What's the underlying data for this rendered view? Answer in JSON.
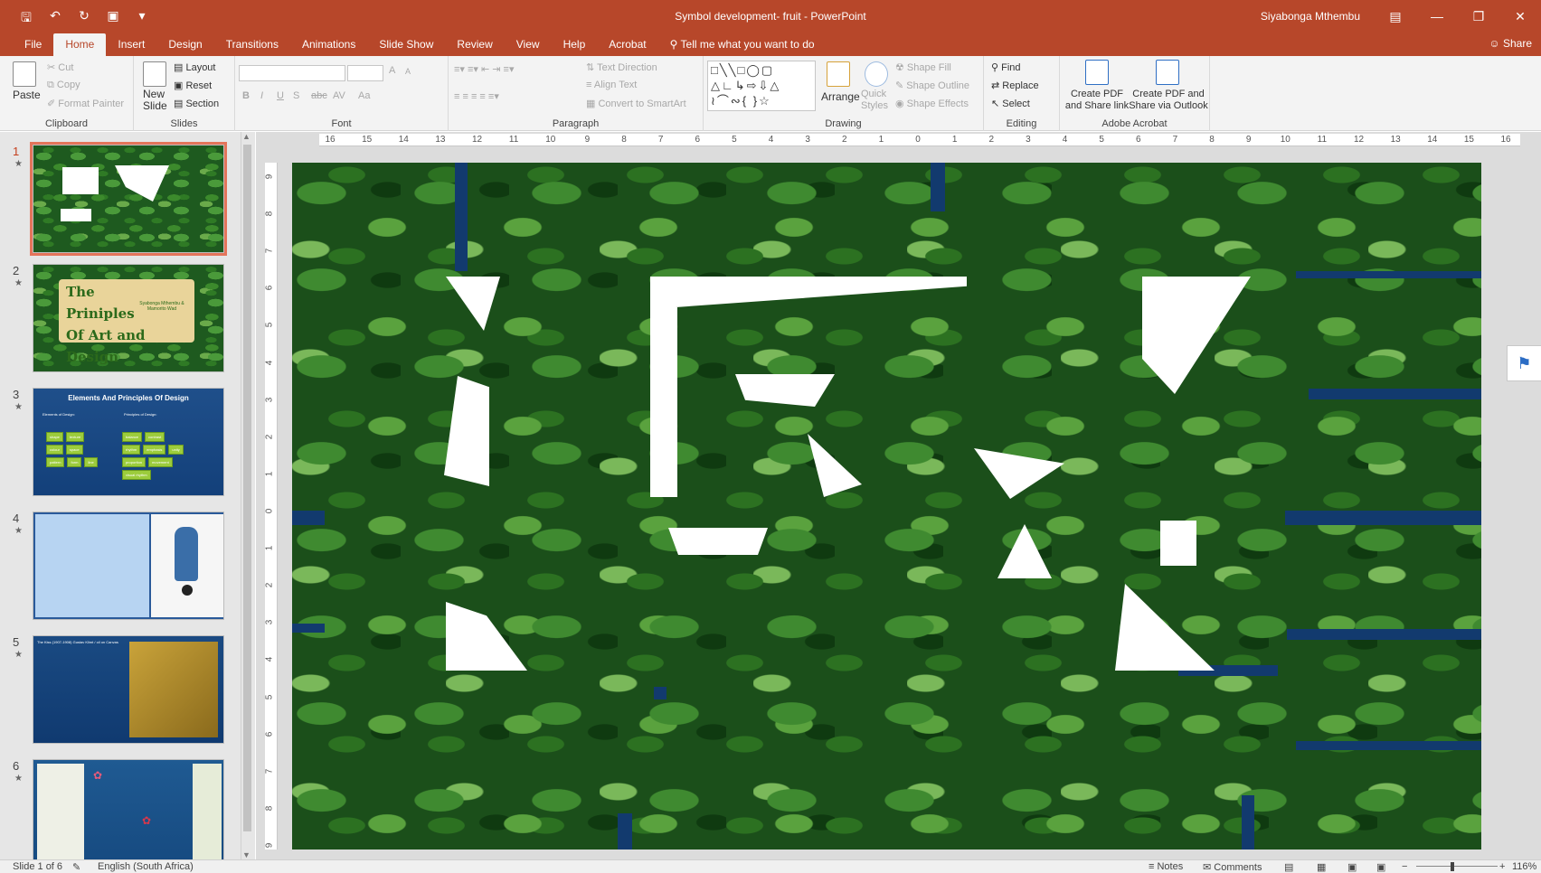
{
  "titlebar": {
    "title": "Symbol development- fruit  -  PowerPoint",
    "user": "Siyabonga Mthembu"
  },
  "tabs": [
    "File",
    "Home",
    "Insert",
    "Design",
    "Transitions",
    "Animations",
    "Slide Show",
    "Review",
    "View",
    "Help",
    "Acrobat"
  ],
  "active_tab": "Home",
  "tell_me": "Tell me what you want to do",
  "share": "Share",
  "ribbon": {
    "clipboard": {
      "label": "Clipboard",
      "paste": "Paste",
      "cut": "Cut",
      "copy": "Copy",
      "format_painter": "Format Painter"
    },
    "slides": {
      "label": "Slides",
      "new_slide_1": "New",
      "new_slide_2": "Slide",
      "layout": "Layout",
      "reset": "Reset",
      "section": "Section"
    },
    "font": {
      "label": "Font",
      "bold": "B",
      "italic": "I",
      "underline": "U",
      "shadow": "S",
      "strike": "abc",
      "spacing": "AV",
      "case": "Aa",
      "grow": "A",
      "shrink": "A"
    },
    "paragraph": {
      "label": "Paragraph",
      "text_direction": "Text Direction",
      "align_text": "Align Text",
      "convert_smartart": "Convert to SmartArt"
    },
    "drawing": {
      "label": "Drawing",
      "arrange": "Arrange",
      "quick_styles_1": "Quick",
      "quick_styles_2": "Styles",
      "shape_fill": "Shape Fill",
      "shape_outline": "Shape Outline",
      "shape_effects": "Shape Effects"
    },
    "editing": {
      "label": "Editing",
      "find": "Find",
      "replace": "Replace",
      "select": "Select"
    },
    "acrobat": {
      "label": "Adobe Acrobat",
      "create_link_1": "Create PDF",
      "create_link_2": "and Share link",
      "create_outlook_1": "Create PDF and",
      "create_outlook_2": "Share via Outlook"
    }
  },
  "thumbnails": [
    {
      "num": "1",
      "selected": true,
      "title": ""
    },
    {
      "num": "2",
      "selected": false,
      "title": "The Priniples Of Art and Design",
      "subtitle": "Syabonga Mthembu & Mamorito Wad"
    },
    {
      "num": "3",
      "selected": false,
      "title": "Elements And Principles Of Design",
      "left_head": "Elements of Design:",
      "right_head": "Principles of Design:",
      "elements": [
        "shape",
        "texture",
        "colour",
        "space",
        "pattern",
        "form",
        "line"
      ],
      "principles": [
        "balance",
        "contrast",
        "rhythm",
        "emphasis",
        "unity",
        "proportion",
        "movement",
        "visual rhythm"
      ]
    },
    {
      "num": "4",
      "selected": false,
      "title": ""
    },
    {
      "num": "5",
      "selected": false,
      "title": "The Kiss (1907-1908) Gustav Klimt / oil on Canvas"
    },
    {
      "num": "6",
      "selected": false,
      "title": ""
    }
  ],
  "ruler": {
    "h_ticks": [
      "16",
      "15",
      "14",
      "13",
      "12",
      "11",
      "10",
      "9",
      "8",
      "7",
      "6",
      "5",
      "4",
      "3",
      "2",
      "1",
      "0",
      "1",
      "2",
      "3",
      "4",
      "5",
      "6",
      "7",
      "8",
      "9",
      "10",
      "11",
      "12",
      "13",
      "14",
      "15",
      "16"
    ],
    "v_ticks": [
      "9",
      "8",
      "7",
      "6",
      "5",
      "4",
      "3",
      "2",
      "1",
      "0",
      "1",
      "2",
      "3",
      "4",
      "5",
      "6",
      "7",
      "8",
      "9"
    ]
  },
  "status": {
    "slide": "Slide 1 of 6",
    "language": "English (South Africa)",
    "notes": "Notes",
    "comments": "Comments",
    "zoom": "116%"
  },
  "colors": {
    "accent": "#b7472a",
    "leaf_green": "#1b4f1a",
    "stripe_blue": "#123a6e"
  }
}
